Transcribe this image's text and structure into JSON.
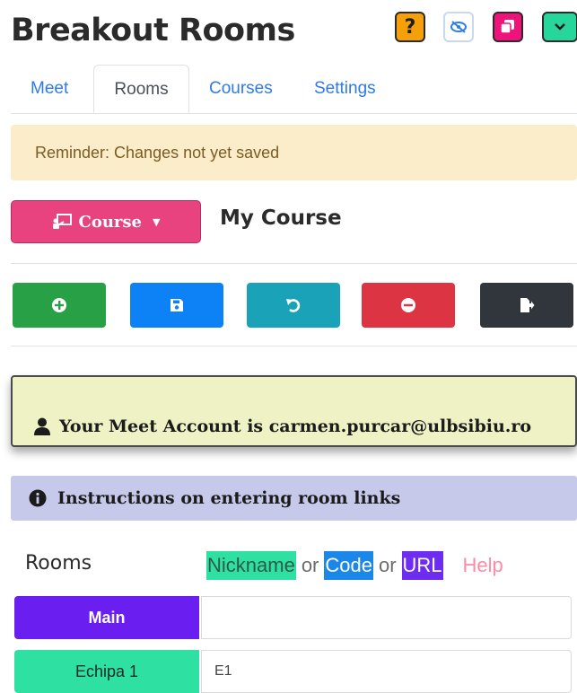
{
  "header": {
    "title": "Breakout Rooms",
    "buttons": [
      {
        "name": "help",
        "icon": "question-mark-icon",
        "label": "?"
      },
      {
        "name": "hide",
        "icon": "eye-slash-icon"
      },
      {
        "name": "copy",
        "icon": "copy-icon"
      },
      {
        "name": "toggle",
        "icon": "chevron-down-icon"
      }
    ]
  },
  "tabs": [
    {
      "label": "Meet",
      "active": false
    },
    {
      "label": "Rooms",
      "active": true
    },
    {
      "label": "Courses",
      "active": false
    },
    {
      "label": "Settings",
      "active": false
    }
  ],
  "reminder": "Reminder: Changes not yet saved",
  "course": {
    "button_label": "Course",
    "button_icon": "chalkboard-teacher-icon",
    "name": "My Course"
  },
  "actions": [
    {
      "name": "add",
      "icon": "plus-circle-icon",
      "color": "#28a146"
    },
    {
      "name": "save",
      "icon": "floppy-disk-icon",
      "color": "#0d82f7"
    },
    {
      "name": "undo",
      "icon": "undo-icon",
      "color": "#1aa3b8"
    },
    {
      "name": "remove",
      "icon": "minus-circle-icon",
      "color": "#dd3444"
    },
    {
      "name": "export",
      "icon": "file-export-icon",
      "color": "#31363c"
    }
  ],
  "account": {
    "icon": "user-icon",
    "text": "Your Meet Account is carmen.purcar@ulbsibiu.ro"
  },
  "instructions": {
    "icon": "info-circle-icon",
    "text": "Instructions on entering room links"
  },
  "rooms": {
    "label": "Rooms",
    "legend": {
      "nickname": "Nickname",
      "or1": "or",
      "code": "Code",
      "or2": "or",
      "url": "URL",
      "help": "Help"
    },
    "items": [
      {
        "name": "Main",
        "value": "",
        "color": "#6a1ff0"
      },
      {
        "name": "Echipa 1",
        "value": "E1",
        "color": "#2fe0a3"
      }
    ]
  }
}
